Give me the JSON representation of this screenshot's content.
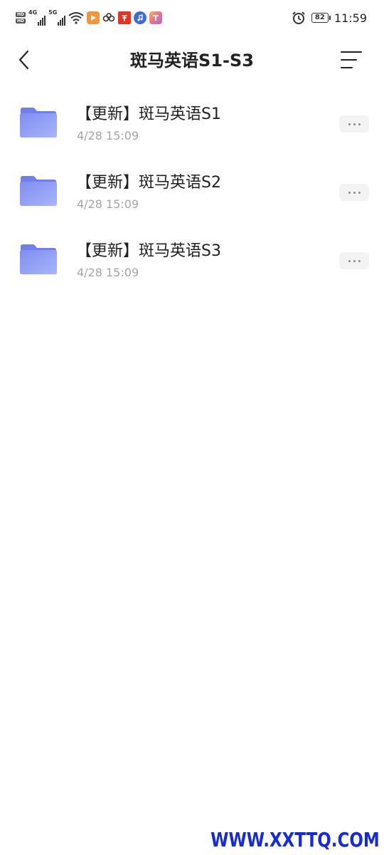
{
  "status_bar": {
    "hd_labels": [
      "HD",
      "HD"
    ],
    "net1_label": "4G",
    "net2_label": "5G",
    "battery": "82",
    "time": "11:59",
    "app_icons": [
      "video-app-icon",
      "infinity-app-icon",
      "red-app-icon",
      "music-app-icon",
      "tool-app-icon"
    ],
    "colors": {
      "video_app": "#f4953a",
      "red_app": "#e9311f",
      "music_app": "#3b6bd9",
      "tool_app": "#f0708a"
    }
  },
  "header": {
    "title": "斑马英语S1-S3"
  },
  "files": [
    {
      "name": "【更新】斑马英语S1",
      "date": "4/28 15:09"
    },
    {
      "name": "【更新】斑马英语S2",
      "date": "4/28 15:09"
    },
    {
      "name": "【更新】斑马英语S3",
      "date": "4/28 15:09"
    }
  ],
  "colors": {
    "folder_top": "#7f8df2",
    "folder_bottom": "#a9b4fb",
    "watermark": "#1428e6"
  },
  "watermark": "WWW.XXTTQ.COM"
}
